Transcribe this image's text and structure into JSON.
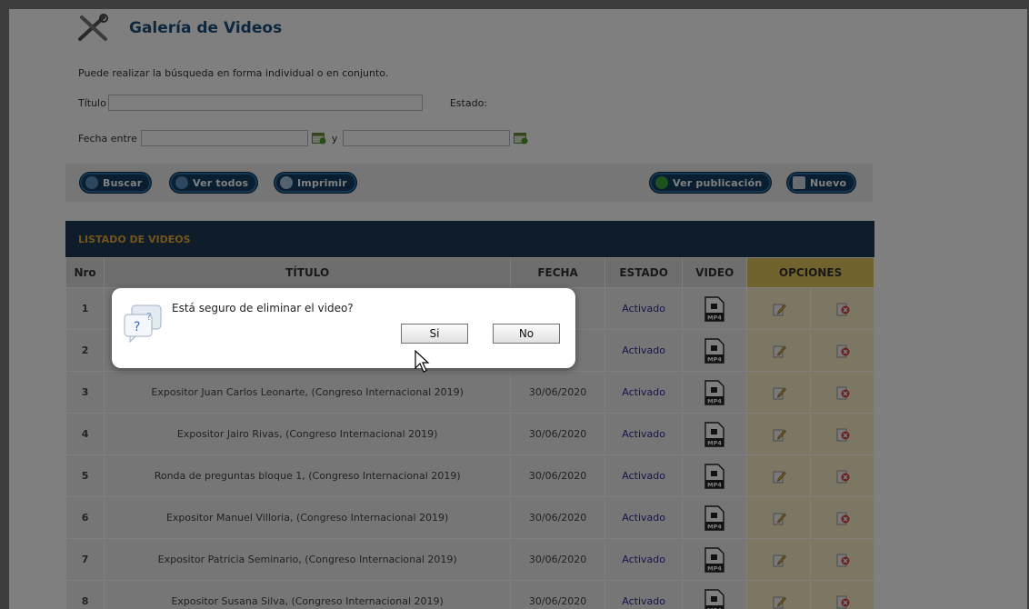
{
  "header": {
    "title": "Galería de Videos",
    "icon": "tools-icon"
  },
  "search": {
    "hint": "Puede realizar la búsqueda en forma individual o en conjunto.",
    "titulo_label": "Título",
    "titulo_value": "",
    "estado_label": "Estado:",
    "fecha_label": "Fecha entre",
    "fecha_desde": "",
    "y_label": "y",
    "fecha_hasta": ""
  },
  "toolbar": {
    "buscar": "Buscar",
    "ver_todos": "Ver todos",
    "imprimir": "Imprimir",
    "ver_publicacion": "Ver publicación",
    "nuevo": "Nuevo"
  },
  "table": {
    "title": "LISTADO DE VIDEOS",
    "columns": [
      "Nro",
      "TÍTULO",
      "FECHA",
      "ESTADO",
      "VIDEO",
      "OPCIONES"
    ],
    "rows": [
      {
        "nro": "1",
        "titulo": "",
        "fecha": "",
        "estado": "Activado"
      },
      {
        "nro": "2",
        "titulo": "",
        "fecha": "",
        "estado": "Activado"
      },
      {
        "nro": "3",
        "titulo": "Expositor Juan Carlos Leonarte, (Congreso Internacional 2019)",
        "fecha": "30/06/2020",
        "estado": "Activado"
      },
      {
        "nro": "4",
        "titulo": "Expositor Jairo Rivas, (Congreso Internacional 2019)",
        "fecha": "30/06/2020",
        "estado": "Activado"
      },
      {
        "nro": "5",
        "titulo": "Ronda de preguntas bloque 1, (Congreso Internacional 2019)",
        "fecha": "30/06/2020",
        "estado": "Activado"
      },
      {
        "nro": "6",
        "titulo": "Expositor Manuel Villoria, (Congreso Internacional 2019)",
        "fecha": "30/06/2020",
        "estado": "Activado"
      },
      {
        "nro": "7",
        "titulo": "Expositor Patricia Seminario, (Congreso Internacional 2019)",
        "fecha": "30/06/2020",
        "estado": "Activado"
      },
      {
        "nro": "8",
        "titulo": "Expositor Susana Silva, (Congreso Internacional 2019)",
        "fecha": "30/06/2020",
        "estado": "Activado"
      }
    ],
    "video_icon_label": "MP4"
  },
  "dialog": {
    "message": "Está seguro de eliminar el video?",
    "yes": "Si",
    "no": "No",
    "icon": "question-icon"
  },
  "colors": {
    "title": "#1e4f7a",
    "button_bg": "#123d63",
    "list_header_bg": "#1e3a57",
    "list_header_text": "#e8a93a",
    "estado_link": "#2a2aa0",
    "options_header": "#e3c75a"
  }
}
